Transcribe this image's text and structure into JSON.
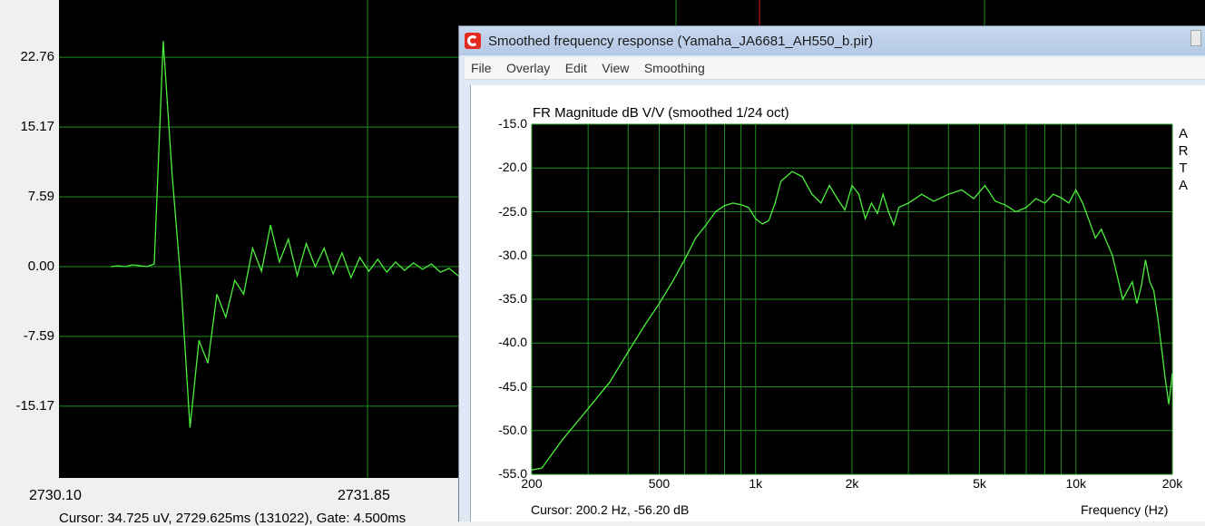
{
  "background_window": {
    "y_ticks": [
      "22.76",
      "15.17",
      "7.59",
      "0.00",
      "-7.59",
      "-15.17"
    ],
    "x_ticks": [
      "2730.10",
      "2731.85"
    ],
    "status_text": "Cursor: 34.725 uV, 2729.625ms (131022), Gate: 4.500ms"
  },
  "window": {
    "title": "Smoothed frequency response (Yamaha_JA6681_AH550_b.pir)",
    "icon": "arta-app-icon"
  },
  "menu": [
    "File",
    "Overlay",
    "Edit",
    "View",
    "Smoothing"
  ],
  "plot": {
    "watermark": [
      "A",
      "R",
      "T",
      "A"
    ],
    "cursor_text": "Cursor: 200.2 Hz, -56.20 dB"
  },
  "chart_data": [
    {
      "type": "line",
      "title": "",
      "xlabel": "",
      "ylabel": "",
      "x_tick_labels": [
        "2730.10",
        "2731.85"
      ],
      "y_tick_labels": [
        "22.76",
        "15.17",
        "7.59",
        "0.00",
        "-7.59",
        "-15.17"
      ],
      "ylim": [
        -22.76,
        26.0
      ],
      "grid": true,
      "series": [
        {
          "color": "#4cf03c",
          "x": [
            0,
            1,
            2,
            3,
            4,
            5,
            6,
            7,
            8,
            9,
            10,
            11,
            12,
            13,
            14,
            15,
            16,
            17,
            18,
            19,
            20,
            21,
            22,
            23,
            24,
            25,
            26,
            27,
            28,
            29,
            30,
            31,
            32,
            33,
            34,
            35,
            36,
            37,
            38,
            39,
            40
          ],
          "y": [
            0.0,
            0.1,
            0.0,
            0.2,
            0.1,
            0.0,
            0.3,
            24.5,
            10.0,
            -2.0,
            -17.5,
            -8.0,
            -10.5,
            -3.0,
            -5.5,
            -1.5,
            -3.0,
            2.0,
            -0.5,
            4.5,
            0.5,
            3.0,
            -1.0,
            2.5,
            0.0,
            2.0,
            -0.8,
            1.5,
            -1.2,
            1.0,
            -0.5,
            0.8,
            -0.6,
            0.5,
            -0.4,
            0.4,
            -0.3,
            0.3,
            -0.6,
            -0.2,
            -1.0
          ]
        }
      ]
    },
    {
      "type": "line",
      "title": "FR Magnitude dB V/V (smoothed 1/24 oct)",
      "xlabel": "Frequency (Hz)",
      "ylabel": "",
      "x_scale": "log",
      "xlim": [
        200,
        20000
      ],
      "ylim": [
        -55.0,
        -15.0
      ],
      "x_tick_labels": [
        "200",
        "500",
        "1k",
        "2k",
        "5k",
        "10k",
        "20k"
      ],
      "x_tick_values": [
        200,
        500,
        1000,
        2000,
        5000,
        10000,
        20000
      ],
      "y_tick_labels": [
        "-15.0",
        "-20.0",
        "-25.0",
        "-30.0",
        "-35.0",
        "-40.0",
        "-45.0",
        "-50.0",
        "-55.0"
      ],
      "y_tick_values": [
        -15,
        -20,
        -25,
        -30,
        -35,
        -40,
        -45,
        -50,
        -55
      ],
      "grid": true,
      "series": [
        {
          "color": "#4cf03c",
          "x": [
            200,
            215,
            250,
            300,
            350,
            400,
            450,
            500,
            550,
            600,
            650,
            700,
            750,
            800,
            850,
            900,
            950,
            1000,
            1050,
            1100,
            1150,
            1200,
            1300,
            1400,
            1500,
            1600,
            1700,
            1800,
            1900,
            2000,
            2100,
            2200,
            2300,
            2400,
            2500,
            2600,
            2700,
            2800,
            3000,
            3300,
            3600,
            4000,
            4400,
            4800,
            5200,
            5600,
            6000,
            6500,
            7000,
            7500,
            8000,
            8500,
            9000,
            9500,
            10000,
            10500,
            11000,
            11500,
            12000,
            13000,
            14000,
            15000,
            15500,
            16000,
            16500,
            17000,
            17500,
            18000,
            18500,
            19000,
            19500,
            20000
          ],
          "y": [
            -54.5,
            -54.3,
            -51.0,
            -47.5,
            -44.5,
            -41.0,
            -38.0,
            -35.5,
            -33.0,
            -30.5,
            -28.0,
            -26.5,
            -25.0,
            -24.3,
            -24.0,
            -24.2,
            -24.5,
            -25.8,
            -26.4,
            -26.0,
            -24.0,
            -21.5,
            -20.4,
            -21.0,
            -23.0,
            -24.0,
            -22.0,
            -23.5,
            -24.8,
            -22.0,
            -23.0,
            -25.8,
            -24.0,
            -25.2,
            -23.0,
            -25.0,
            -26.5,
            -24.5,
            -24.0,
            -23.0,
            -23.8,
            -23.0,
            -22.5,
            -23.5,
            -22.0,
            -23.8,
            -24.2,
            -25.0,
            -24.5,
            -23.5,
            -24.0,
            -23.0,
            -23.4,
            -24.0,
            -22.5,
            -24.0,
            -26.0,
            -28.0,
            -27.0,
            -30.0,
            -35.0,
            -33.0,
            -35.5,
            -33.5,
            -30.5,
            -33.0,
            -34.0,
            -37.0,
            -40.5,
            -44.0,
            -47.0,
            -43.5
          ]
        }
      ]
    }
  ]
}
